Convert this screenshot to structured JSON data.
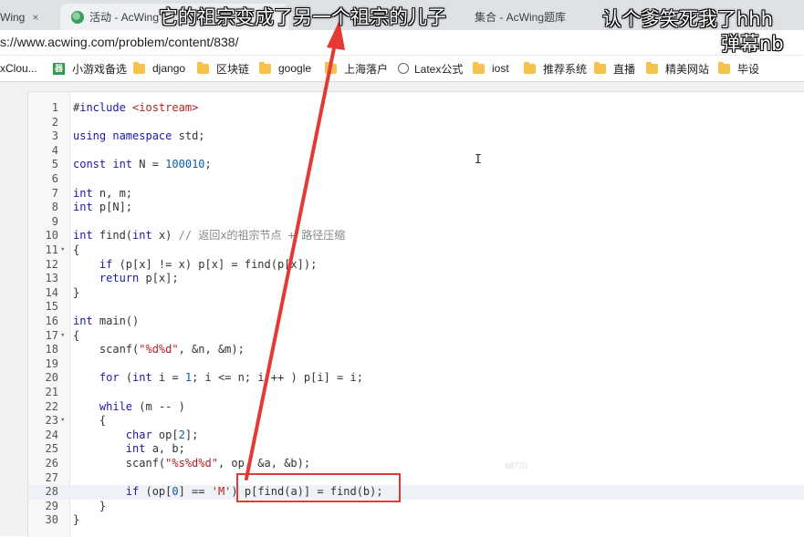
{
  "browser": {
    "tabs": [
      {
        "label": "Wing"
      },
      {
        "label": "活动 - AcWing"
      },
      {
        "label": "集合 - AcWing题库"
      }
    ],
    "close_glyph": "×",
    "url": "s://www.acwing.com/problem/content/838/",
    "bookmarks": [
      {
        "label": "xClou...",
        "icon": "none"
      },
      {
        "label": "小游戏备选",
        "icon": "game-icon"
      },
      {
        "label": "django",
        "icon": "folder-icon"
      },
      {
        "label": "区块链",
        "icon": "folder-icon"
      },
      {
        "label": "google",
        "icon": "folder-icon"
      },
      {
        "label": "上海落户",
        "icon": "folder-icon"
      },
      {
        "label": "Latex公式",
        "icon": "globe-icon"
      },
      {
        "label": "iost",
        "icon": "folder-icon"
      },
      {
        "label": "推荐系统",
        "icon": "folder-icon"
      },
      {
        "label": "直播",
        "icon": "folder-icon"
      },
      {
        "label": "精美网站",
        "icon": "folder-icon"
      },
      {
        "label": "毕设",
        "icon": "folder-icon"
      }
    ],
    "game_icon_glyph": "器"
  },
  "editor": {
    "active_line": 28,
    "lines": [
      {
        "n": "1",
        "fold": "",
        "code": "#include <iostream>"
      },
      {
        "n": "2",
        "fold": "",
        "code": ""
      },
      {
        "n": "3",
        "fold": "",
        "code": "using namespace std;"
      },
      {
        "n": "4",
        "fold": "",
        "code": ""
      },
      {
        "n": "5",
        "fold": "",
        "code": "const int N = 100010;"
      },
      {
        "n": "6",
        "fold": "",
        "code": ""
      },
      {
        "n": "7",
        "fold": "",
        "code": "int n, m;"
      },
      {
        "n": "8",
        "fold": "",
        "code": "int p[N];"
      },
      {
        "n": "9",
        "fold": "",
        "code": ""
      },
      {
        "n": "10",
        "fold": "",
        "code": "int find(int x) // 返回x的祖宗节点 + 路径压缩"
      },
      {
        "n": "11",
        "fold": "▾",
        "code": "{"
      },
      {
        "n": "12",
        "fold": "",
        "code": "    if (p[x] != x) p[x] = find(p[x]);"
      },
      {
        "n": "13",
        "fold": "",
        "code": "    return p[x];"
      },
      {
        "n": "14",
        "fold": "",
        "code": "}"
      },
      {
        "n": "15",
        "fold": "",
        "code": ""
      },
      {
        "n": "16",
        "fold": "",
        "code": "int main()"
      },
      {
        "n": "17",
        "fold": "▾",
        "code": "{"
      },
      {
        "n": "18",
        "fold": "",
        "code": "    scanf(\"%d%d\", &n, &m);"
      },
      {
        "n": "19",
        "fold": "",
        "code": ""
      },
      {
        "n": "20",
        "fold": "",
        "code": "    for (int i = 1; i <= n; i ++ ) p[i] = i;"
      },
      {
        "n": "21",
        "fold": "",
        "code": ""
      },
      {
        "n": "22",
        "fold": "",
        "code": "    while (m -- )"
      },
      {
        "n": "23",
        "fold": "▾",
        "code": "    {"
      },
      {
        "n": "24",
        "fold": "",
        "code": "        char op[2];"
      },
      {
        "n": "25",
        "fold": "",
        "code": "        int a, b;"
      },
      {
        "n": "26",
        "fold": "",
        "code": "        scanf(\"%s%d%d\", op, &a, &b);"
      },
      {
        "n": "27",
        "fold": "",
        "code": ""
      },
      {
        "n": "28",
        "fold": "",
        "code": "        if (op[0] == 'M') p[find(a)] = find(b);"
      },
      {
        "n": "29",
        "fold": "",
        "code": "    }"
      },
      {
        "n": "30",
        "fold": "",
        "code": "}"
      }
    ],
    "cursor_glyph": "I",
    "watermark": "68770"
  },
  "danmaku": [
    {
      "text": "它的祖宗变成了另一个祖宗的儿子"
    },
    {
      "text": "认个爹笑死我了hhh"
    },
    {
      "text": "弹幕nb"
    }
  ],
  "colors": {
    "annotation": "#e53935",
    "keyword": "#1a1aa6",
    "string": "#b22222",
    "number": "#0b5fa5",
    "comment": "#888888"
  }
}
